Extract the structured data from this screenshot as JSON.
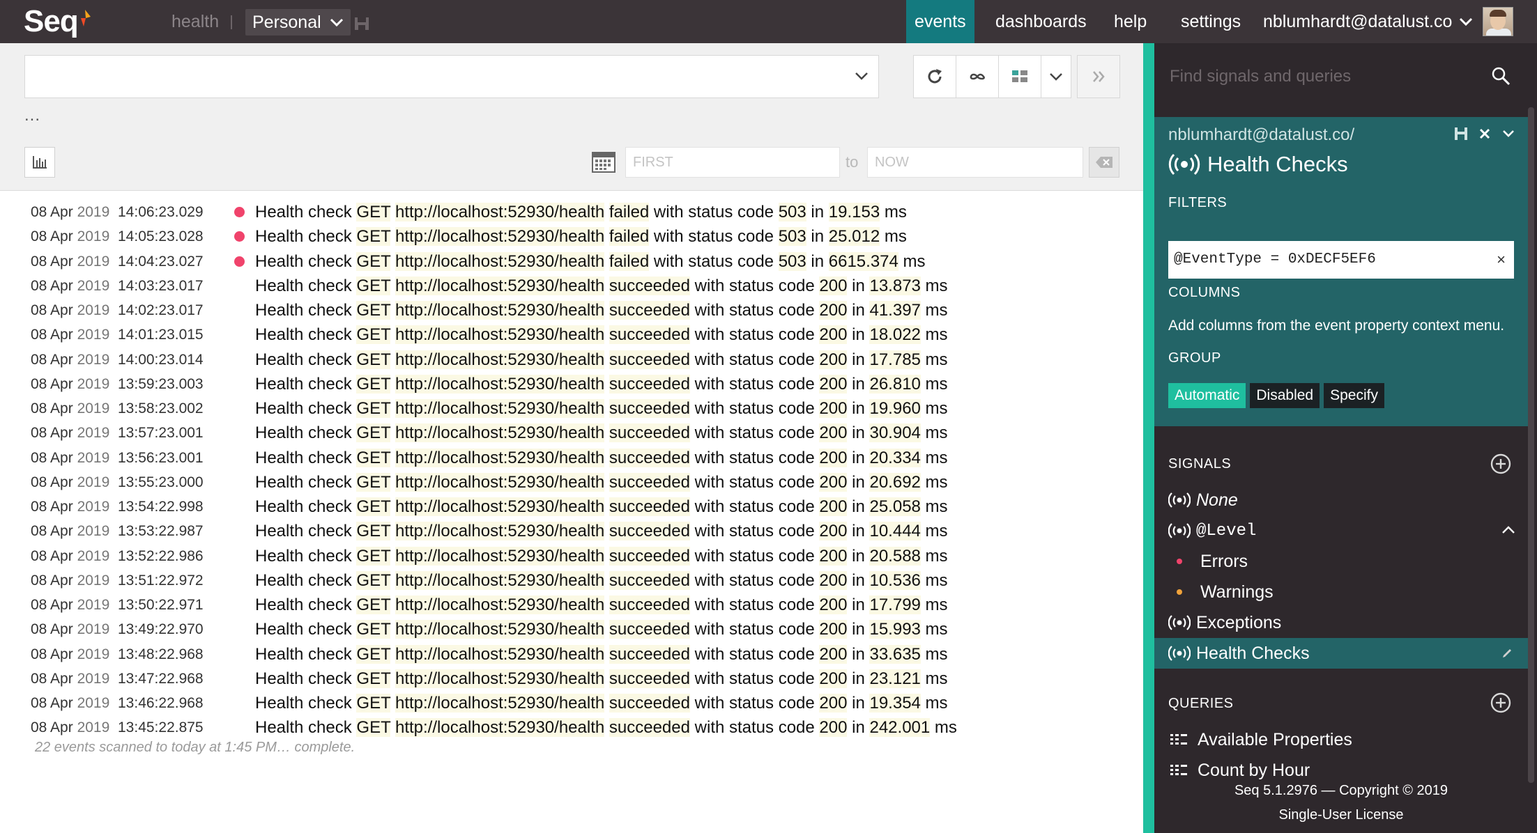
{
  "app": {
    "logo_text": "Seq",
    "workspace_health": "health",
    "workspace_selected": "Personal"
  },
  "nav": {
    "events": "events",
    "dashboards": "dashboards",
    "help": "help",
    "settings": "settings",
    "user": "nblumhardt@datalust.co"
  },
  "query": {
    "value": "",
    "placeholder": "",
    "ellipsis": "...",
    "range_from_placeholder": "FIRST",
    "range_to_label": "to",
    "range_to_placeholder": "NOW"
  },
  "events": [
    {
      "day": "08 Apr",
      "year": "2019",
      "time": "14:06:23.029",
      "level": "error",
      "pre": "Health check ",
      "method": "GET",
      "url": "http://localhost:52930/health",
      "outcome": "failed",
      "code_label": " with status code ",
      "code": "503",
      "in": " in ",
      "elapsed": "19.153",
      "unit": " ms"
    },
    {
      "day": "08 Apr",
      "year": "2019",
      "time": "14:05:23.028",
      "level": "error",
      "pre": "Health check ",
      "method": "GET",
      "url": "http://localhost:52930/health",
      "outcome": "failed",
      "code_label": " with status code ",
      "code": "503",
      "in": " in ",
      "elapsed": "25.012",
      "unit": " ms"
    },
    {
      "day": "08 Apr",
      "year": "2019",
      "time": "14:04:23.027",
      "level": "error",
      "pre": "Health check ",
      "method": "GET",
      "url": "http://localhost:52930/health",
      "outcome": "failed",
      "code_label": " with status code ",
      "code": "503",
      "in": " in ",
      "elapsed": "6615.374",
      "unit": " ms"
    },
    {
      "day": "08 Apr",
      "year": "2019",
      "time": "14:03:23.017",
      "level": "info",
      "pre": "Health check ",
      "method": "GET",
      "url": "http://localhost:52930/health",
      "outcome": "succeeded",
      "code_label": " with status code ",
      "code": "200",
      "in": " in ",
      "elapsed": "13.873",
      "unit": " ms"
    },
    {
      "day": "08 Apr",
      "year": "2019",
      "time": "14:02:23.017",
      "level": "info",
      "pre": "Health check ",
      "method": "GET",
      "url": "http://localhost:52930/health",
      "outcome": "succeeded",
      "code_label": " with status code ",
      "code": "200",
      "in": " in ",
      "elapsed": "41.397",
      "unit": " ms"
    },
    {
      "day": "08 Apr",
      "year": "2019",
      "time": "14:01:23.015",
      "level": "info",
      "pre": "Health check ",
      "method": "GET",
      "url": "http://localhost:52930/health",
      "outcome": "succeeded",
      "code_label": " with status code ",
      "code": "200",
      "in": " in ",
      "elapsed": "18.022",
      "unit": " ms"
    },
    {
      "day": "08 Apr",
      "year": "2019",
      "time": "14:00:23.014",
      "level": "info",
      "pre": "Health check ",
      "method": "GET",
      "url": "http://localhost:52930/health",
      "outcome": "succeeded",
      "code_label": " with status code ",
      "code": "200",
      "in": " in ",
      "elapsed": "17.785",
      "unit": " ms"
    },
    {
      "day": "08 Apr",
      "year": "2019",
      "time": "13:59:23.003",
      "level": "info",
      "pre": "Health check ",
      "method": "GET",
      "url": "http://localhost:52930/health",
      "outcome": "succeeded",
      "code_label": " with status code ",
      "code": "200",
      "in": " in ",
      "elapsed": "26.810",
      "unit": " ms"
    },
    {
      "day": "08 Apr",
      "year": "2019",
      "time": "13:58:23.002",
      "level": "info",
      "pre": "Health check ",
      "method": "GET",
      "url": "http://localhost:52930/health",
      "outcome": "succeeded",
      "code_label": " with status code ",
      "code": "200",
      "in": " in ",
      "elapsed": "19.960",
      "unit": " ms"
    },
    {
      "day": "08 Apr",
      "year": "2019",
      "time": "13:57:23.001",
      "level": "info",
      "pre": "Health check ",
      "method": "GET",
      "url": "http://localhost:52930/health",
      "outcome": "succeeded",
      "code_label": " with status code ",
      "code": "200",
      "in": " in ",
      "elapsed": "30.904",
      "unit": " ms"
    },
    {
      "day": "08 Apr",
      "year": "2019",
      "time": "13:56:23.001",
      "level": "info",
      "pre": "Health check ",
      "method": "GET",
      "url": "http://localhost:52930/health",
      "outcome": "succeeded",
      "code_label": " with status code ",
      "code": "200",
      "in": " in ",
      "elapsed": "20.334",
      "unit": " ms"
    },
    {
      "day": "08 Apr",
      "year": "2019",
      "time": "13:55:23.000",
      "level": "info",
      "pre": "Health check ",
      "method": "GET",
      "url": "http://localhost:52930/health",
      "outcome": "succeeded",
      "code_label": " with status code ",
      "code": "200",
      "in": " in ",
      "elapsed": "20.692",
      "unit": " ms"
    },
    {
      "day": "08 Apr",
      "year": "2019",
      "time": "13:54:22.998",
      "level": "info",
      "pre": "Health check ",
      "method": "GET",
      "url": "http://localhost:52930/health",
      "outcome": "succeeded",
      "code_label": " with status code ",
      "code": "200",
      "in": " in ",
      "elapsed": "25.058",
      "unit": " ms"
    },
    {
      "day": "08 Apr",
      "year": "2019",
      "time": "13:53:22.987",
      "level": "info",
      "pre": "Health check ",
      "method": "GET",
      "url": "http://localhost:52930/health",
      "outcome": "succeeded",
      "code_label": " with status code ",
      "code": "200",
      "in": " in ",
      "elapsed": "10.444",
      "unit": " ms"
    },
    {
      "day": "08 Apr",
      "year": "2019",
      "time": "13:52:22.986",
      "level": "info",
      "pre": "Health check ",
      "method": "GET",
      "url": "http://localhost:52930/health",
      "outcome": "succeeded",
      "code_label": " with status code ",
      "code": "200",
      "in": " in ",
      "elapsed": "20.588",
      "unit": " ms"
    },
    {
      "day": "08 Apr",
      "year": "2019",
      "time": "13:51:22.972",
      "level": "info",
      "pre": "Health check ",
      "method": "GET",
      "url": "http://localhost:52930/health",
      "outcome": "succeeded",
      "code_label": " with status code ",
      "code": "200",
      "in": " in ",
      "elapsed": "10.536",
      "unit": " ms"
    },
    {
      "day": "08 Apr",
      "year": "2019",
      "time": "13:50:22.971",
      "level": "info",
      "pre": "Health check ",
      "method": "GET",
      "url": "http://localhost:52930/health",
      "outcome": "succeeded",
      "code_label": " with status code ",
      "code": "200",
      "in": " in ",
      "elapsed": "17.799",
      "unit": " ms"
    },
    {
      "day": "08 Apr",
      "year": "2019",
      "time": "13:49:22.970",
      "level": "info",
      "pre": "Health check ",
      "method": "GET",
      "url": "http://localhost:52930/health",
      "outcome": "succeeded",
      "code_label": " with status code ",
      "code": "200",
      "in": " in ",
      "elapsed": "15.993",
      "unit": " ms"
    },
    {
      "day": "08 Apr",
      "year": "2019",
      "time": "13:48:22.968",
      "level": "info",
      "pre": "Health check ",
      "method": "GET",
      "url": "http://localhost:52930/health",
      "outcome": "succeeded",
      "code_label": " with status code ",
      "code": "200",
      "in": " in ",
      "elapsed": "33.635",
      "unit": " ms"
    },
    {
      "day": "08 Apr",
      "year": "2019",
      "time": "13:47:22.968",
      "level": "info",
      "pre": "Health check ",
      "method": "GET",
      "url": "http://localhost:52930/health",
      "outcome": "succeeded",
      "code_label": " with status code ",
      "code": "200",
      "in": " in ",
      "elapsed": "23.121",
      "unit": " ms"
    },
    {
      "day": "08 Apr",
      "year": "2019",
      "time": "13:46:22.968",
      "level": "info",
      "pre": "Health check ",
      "method": "GET",
      "url": "http://localhost:52930/health",
      "outcome": "succeeded",
      "code_label": " with status code ",
      "code": "200",
      "in": " in ",
      "elapsed": "19.354",
      "unit": " ms"
    },
    {
      "day": "08 Apr",
      "year": "2019",
      "time": "13:45:22.875",
      "level": "info",
      "pre": "Health check ",
      "method": "GET",
      "url": "http://localhost:52930/health",
      "outcome": "succeeded",
      "code_label": " with status code ",
      "code": "200",
      "in": " in ",
      "elapsed": "242.001",
      "unit": " ms"
    }
  ],
  "scan_status": "22 events scanned to today at 1:45 PM… complete.",
  "panel": {
    "search_placeholder": "Find signals and queries",
    "signal_owner": "nblumhardt@datalust.co/",
    "signal_title": "Health Checks",
    "filters_label": "FILTERS",
    "filter_expression": "@EventType = 0xDECF5EF6",
    "filter_clear": "×",
    "columns_label": "COLUMNS",
    "columns_hint": "Add columns from the event property context menu.",
    "group_label": "GROUP",
    "group_options": [
      "Automatic",
      "Disabled",
      "Specify"
    ],
    "group_selected": "Automatic",
    "signals_label": "SIGNALS",
    "signals": {
      "none": "None",
      "level": "@Level",
      "errors": "Errors",
      "warnings": "Warnings",
      "exceptions": "Exceptions",
      "health_checks": "Health Checks"
    },
    "queries_label": "QUERIES",
    "queries": [
      "Available Properties",
      "Count by Hour"
    ],
    "footer_version": "Seq 5.1.2976 — Copyright © 2019",
    "footer_license": "Single-User License"
  },
  "colors": {
    "topbar": "#3b3438",
    "accent_teal": "#1fbf9f",
    "nav_active": "#147a7f",
    "panel_bg": "#2e282c",
    "signal_card": "#236467",
    "error_dot": "#f0436b",
    "warning_dot": "#f0a23a"
  }
}
